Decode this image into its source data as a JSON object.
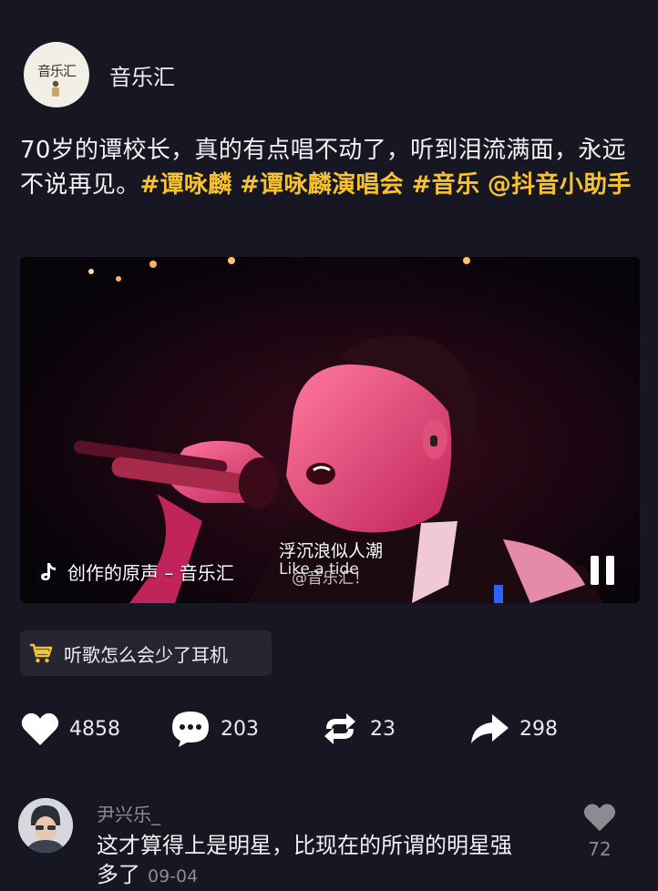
{
  "author": {
    "avatar_text": "音乐汇",
    "name": "音乐汇"
  },
  "caption": {
    "text": "70岁的谭校长，真的有点唱不动了，听到泪流满面，永远不说再见。",
    "hashtags": [
      "#谭咏麟",
      "#谭咏麟演唱会",
      "#音乐",
      "@抖音小助手"
    ]
  },
  "video": {
    "sound_credit": "创作的原声 – 音乐汇",
    "watermark": "@音乐汇！",
    "subtitle_cn": "浮沉浪似人潮",
    "subtitle_en": "Like a tide",
    "icons": {
      "sound": "tiktok-note-icon",
      "control": "pause-icon"
    }
  },
  "product": {
    "label": "听歌怎么会少了耳机",
    "icon": "shopping-cart-icon",
    "icon_color": "#f7c22c"
  },
  "actions": {
    "likes": "4858",
    "comments": "203",
    "reposts": "23",
    "shares": "298"
  },
  "comment": {
    "user": "尹兴乐_",
    "text": "这才算得上是明星，比现在的所谓的明星强多了",
    "time": "09-04",
    "likes": "72"
  },
  "colors": {
    "background": "#161722",
    "hashtag": "#f7c22c",
    "muted": "#8a8b93"
  }
}
